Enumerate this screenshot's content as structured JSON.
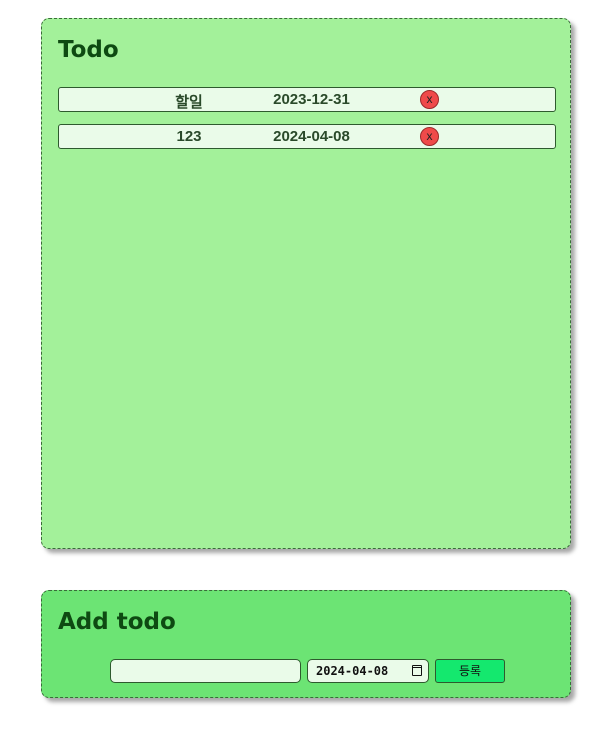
{
  "todo_panel": {
    "title": "Todo",
    "items": [
      {
        "name": "할일",
        "date": "2023-12-31",
        "delete_label": "x"
      },
      {
        "name": "123",
        "date": "2024-04-08",
        "delete_label": "x"
      }
    ]
  },
  "add_panel": {
    "title": "Add todo",
    "text_input_value": "",
    "date_input_value": "2024-04-08",
    "submit_label": "등록"
  },
  "icons": {
    "delete": "close-icon",
    "calendar": "calendar-icon"
  },
  "colors": {
    "todo_panel_bg": "#a3f19a",
    "add_panel_bg": "#6ce474",
    "delete_button": "#ef4a4a",
    "submit_button": "#14e86e",
    "title_text": "#0e4a12"
  }
}
